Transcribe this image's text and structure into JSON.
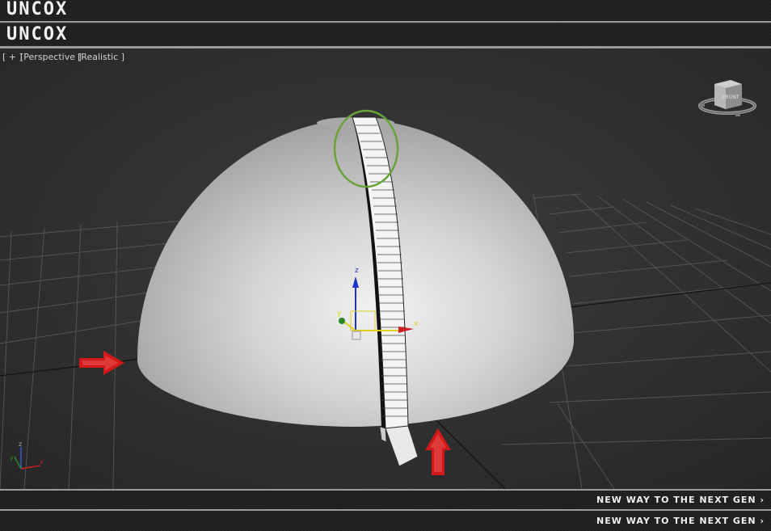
{
  "header": {
    "brand_top": "UNCOX",
    "brand_second": "UNCOX"
  },
  "footer": {
    "tagline_first": "NEW WAY TO THE NEXT GEN ›",
    "tagline_second": "NEW WAY TO THE NEXT GEN ›"
  },
  "viewport": {
    "menu_plus": "[ + ]",
    "view_mode": "[Perspective ]",
    "shading_mode": "[Realistic ]",
    "viewcube_face": "FRONT"
  },
  "gizmo": {
    "axis_z": "z",
    "axis_y": "y",
    "axis_x": "x"
  },
  "axis_tripod": {
    "z": "z",
    "y": "y",
    "x": "x"
  },
  "colors": {
    "highlight_circle": "#6aa33a",
    "arrow_annotation": "#d11919",
    "axis_x": "#cc2222",
    "axis_y": "#2a8a2a",
    "axis_z": "#2233cc"
  }
}
